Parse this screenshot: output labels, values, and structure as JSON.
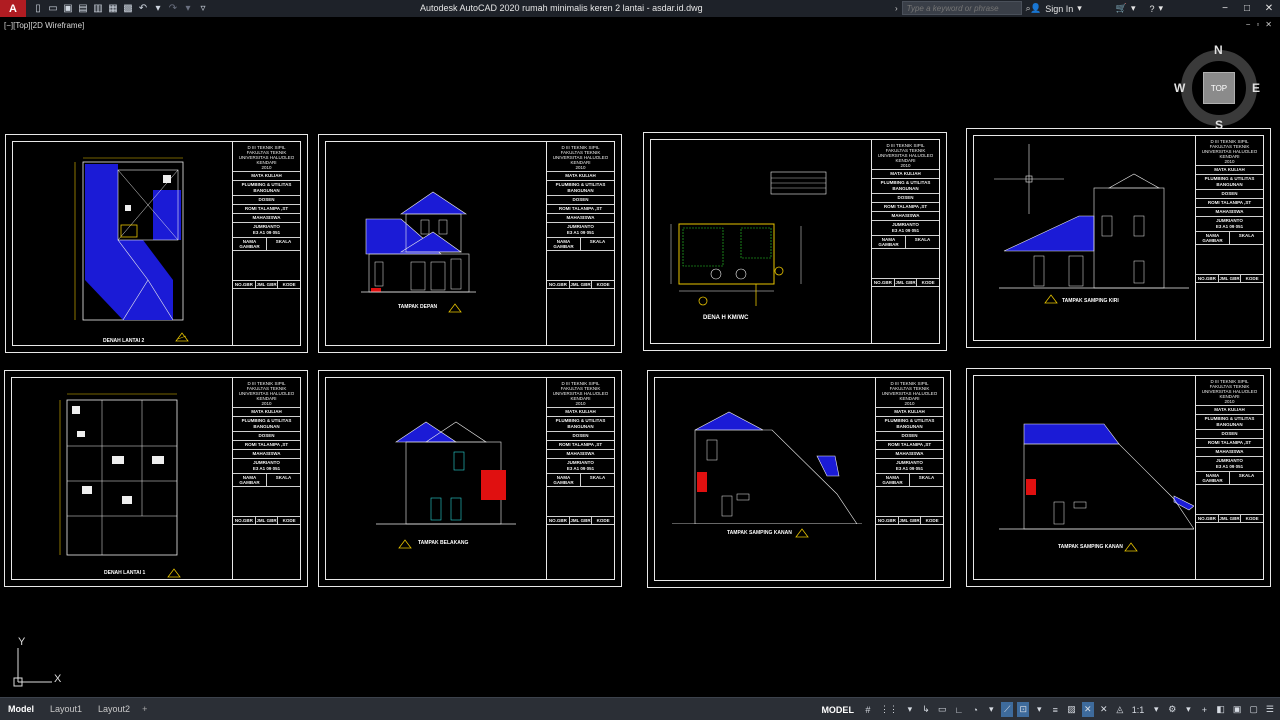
{
  "titlebar": {
    "app_letter": "A",
    "title": "Autodesk AutoCAD 2020    rumah minimalis keren 2 lantai - asdar.id.dwg",
    "search_placeholder": "Type a keyword or phrase",
    "signin": "Sign In"
  },
  "viewport": {
    "label": "[−][Top][2D Wireframe]"
  },
  "viewcube": {
    "top": "TOP",
    "north": "N",
    "south": "S",
    "east": "E",
    "west": "W"
  },
  "title_block": {
    "institution": [
      "D III TEKNIK SIPIL",
      "FAKULTAS TEKNIK",
      "UNIVERSITAS HALUOLEO",
      "KENDARI",
      "2010"
    ],
    "course_label": "MATA KULIAH",
    "course": "PLUMBING & UTILITAS BANGUNAN",
    "lecturer_label": "DOSEN",
    "lecturer": "ROMI TALANIPA ,ST",
    "student_label": "MAHASISWA",
    "student": "JUMRIANTO",
    "student_id": "E3 A1 09 051",
    "drawing_name_label": "NAMA GAMBAR",
    "scale_label": "SKALA",
    "foot": [
      "NO.GBR",
      "JML GBR",
      "KODE"
    ]
  },
  "sheets": [
    {
      "caption": "DENAH LANTAI 2"
    },
    {
      "caption": "TAMPAK DEPAN"
    },
    {
      "caption": "DENA H KM/WC"
    },
    {
      "caption": "TAMPAK SAMPING KIRI"
    },
    {
      "caption": "DENAH LANTAI 1"
    },
    {
      "caption": "TAMPAK BELAKANG"
    },
    {
      "caption": "TAMPAK SAMPING KANAN"
    },
    {
      "caption": "TAMPAK SAMPING KANAN"
    }
  ],
  "ucs": {
    "y": "Y",
    "x": "X"
  },
  "statusbar": {
    "tabs": [
      "Model",
      "Layout1",
      "Layout2"
    ],
    "plus": "+",
    "mode": "MODEL",
    "scale": "1:1"
  },
  "colors": {
    "roof_blue": "#1b1bd6",
    "accent_red": "#e01010",
    "line": "#e8e8e8",
    "highlight_yellow": "#e8c400"
  }
}
